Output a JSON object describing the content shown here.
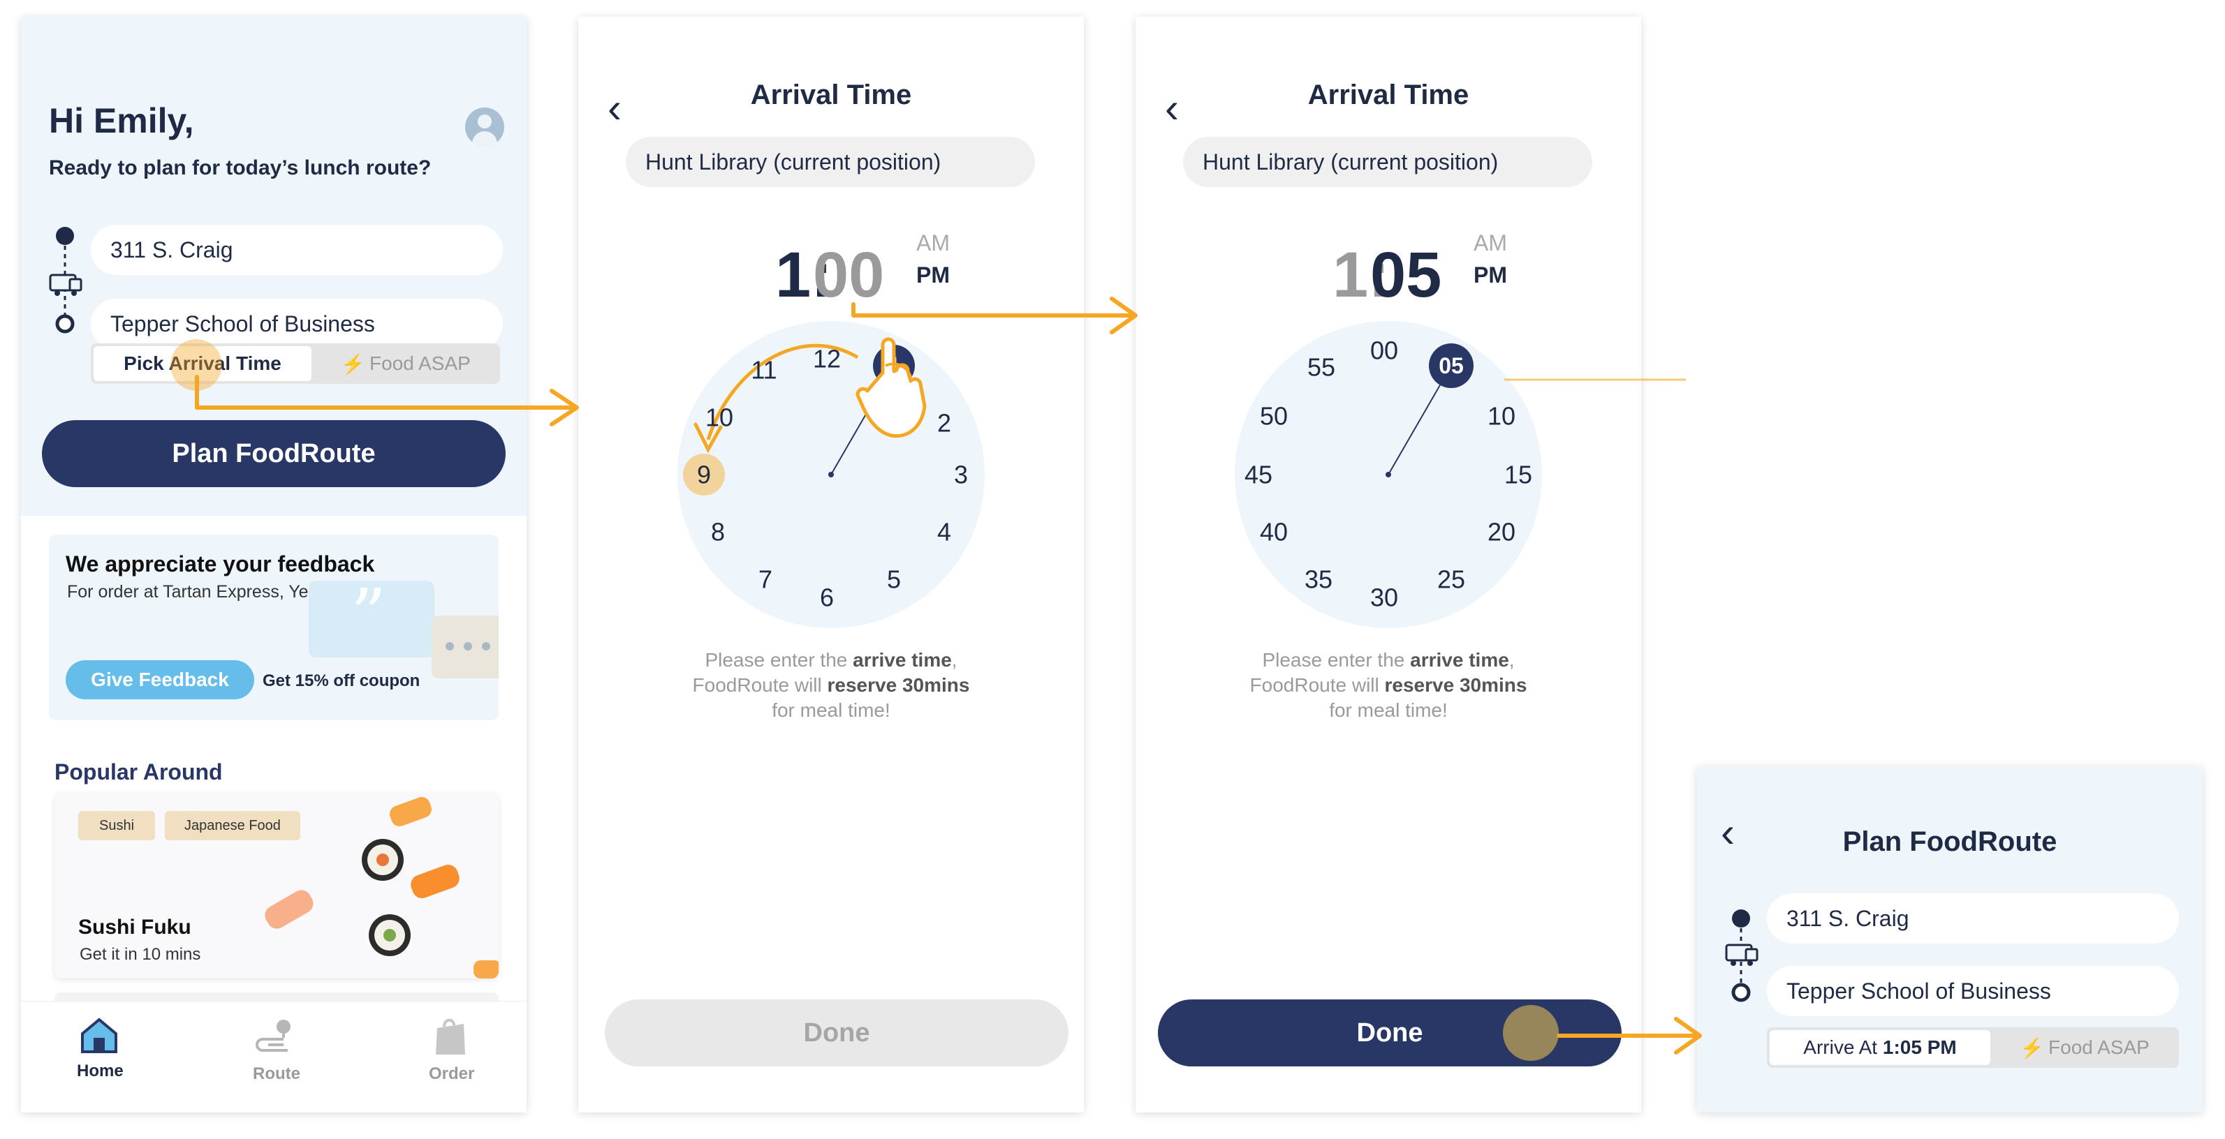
{
  "screen1": {
    "greeting": "Hi Emily,",
    "subtitle": "Ready to plan for today’s lunch route?",
    "from": "311 S. Craig",
    "to": "Tepper School of Business",
    "segment": {
      "active": "Pick Arrival Time",
      "inactive": "Food ASAP"
    },
    "plan_button": "Plan FoodRoute",
    "feedback": {
      "title": "We appreciate your feedback",
      "subtitle": "For order at Tartan Express, Yesterday",
      "button": "Give Feedback",
      "coupon": "Get 15% off coupon",
      "quote_mark": "”"
    },
    "popular": {
      "heading": "Popular Around",
      "tags": [
        "Sushi",
        "Japanese Food"
      ],
      "name": "Sushi Fuku",
      "eta": "Get it in 10 mins"
    },
    "tabs": [
      "Home",
      "Route",
      "Order"
    ]
  },
  "screen2": {
    "title": "Arrival Time",
    "location": "Hunt Library (current position)",
    "hour": "1",
    "colon": ":",
    "minutes": "00",
    "am": "AM",
    "pm": "PM",
    "dial": [
      "12",
      "1",
      "2",
      "3",
      "4",
      "5",
      "6",
      "7",
      "8",
      "9",
      "10",
      "11"
    ],
    "hint": {
      "p1": "Please enter the ",
      "b1": "arrive time",
      "p2": ",",
      "p3": "FoodRoute will ",
      "b2": "reserve 30mins",
      "p4": "for meal time!"
    },
    "done": "Done"
  },
  "screen3": {
    "title": "Arrival Time",
    "location": "Hunt Library (current position)",
    "hour": "1",
    "colon": ":",
    "minutes": "05",
    "am": "AM",
    "pm": "PM",
    "dial": [
      "00",
      "05",
      "10",
      "15",
      "20",
      "25",
      "30",
      "35",
      "40",
      "45",
      "50",
      "55"
    ],
    "hint": {
      "p1": "Please enter the ",
      "b1": "arrive time",
      "p2": ",",
      "p3": "FoodRoute will ",
      "b2": "reserve 30mins",
      "p4": "for meal time!"
    },
    "done": "Done"
  },
  "screen4": {
    "title": "Plan FoodRoute",
    "from": "311 S. Craig",
    "to": "Tepper School of Business",
    "arrive_prefix": "Arrive At ",
    "arrive_time": "1:05 PM",
    "asap": "Food ASAP"
  },
  "colors": {
    "navy": "#283766",
    "accent": "#f5a623",
    "light_bg": "#eef6fb",
    "feedback_blue": "#67bde9"
  }
}
